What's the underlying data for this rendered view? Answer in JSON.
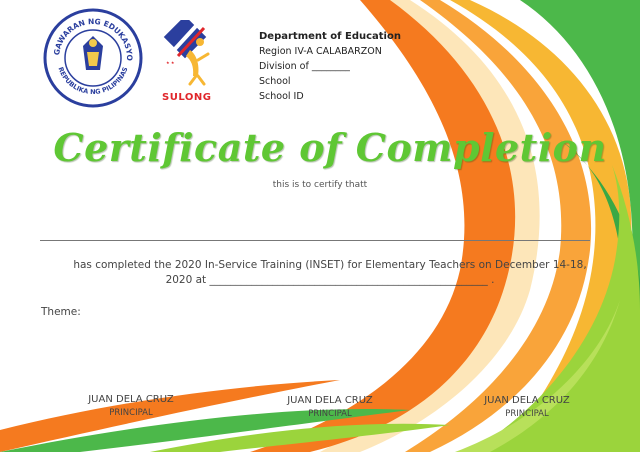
{
  "header": {
    "seal_text_top": "KAGAWARAN NG EDUKASYON",
    "seal_text_bottom": "REPUBLIKA NG PILIPINAS",
    "sulong_label": "SULONG",
    "department": "Department of Education",
    "region": "Region IV-A CALABARZON",
    "division": "Division of ________",
    "school": "School",
    "school_id": "School ID"
  },
  "certificate": {
    "title": "Certificate of Completion",
    "certify_line": "this is to certify thatt",
    "completion_text_1": "has completed the 2020 In-Service Training (INSET) for Elementary Teachers on December 14-18,",
    "completion_text_2": "2020 at _____________________________________________________ .",
    "theme_label": "Theme:"
  },
  "signatories": [
    {
      "name": "JUAN DELA CRUZ",
      "role": "PRINCIPAL"
    },
    {
      "name": "JUAN DELA CRUZ",
      "role": "PRINCIPAL"
    },
    {
      "name": "JUAN DELA CRUZ",
      "role": "PRINCIPAL"
    }
  ],
  "colors": {
    "title_green": "#5fc734",
    "swoosh_orange": "#f57a1f",
    "swoosh_yellow": "#f7b733",
    "swoosh_green": "#4cb84a",
    "swoosh_lime": "#9bd43c",
    "sulong_red": "#e0262b",
    "seal_blue": "#2b3f9e"
  }
}
